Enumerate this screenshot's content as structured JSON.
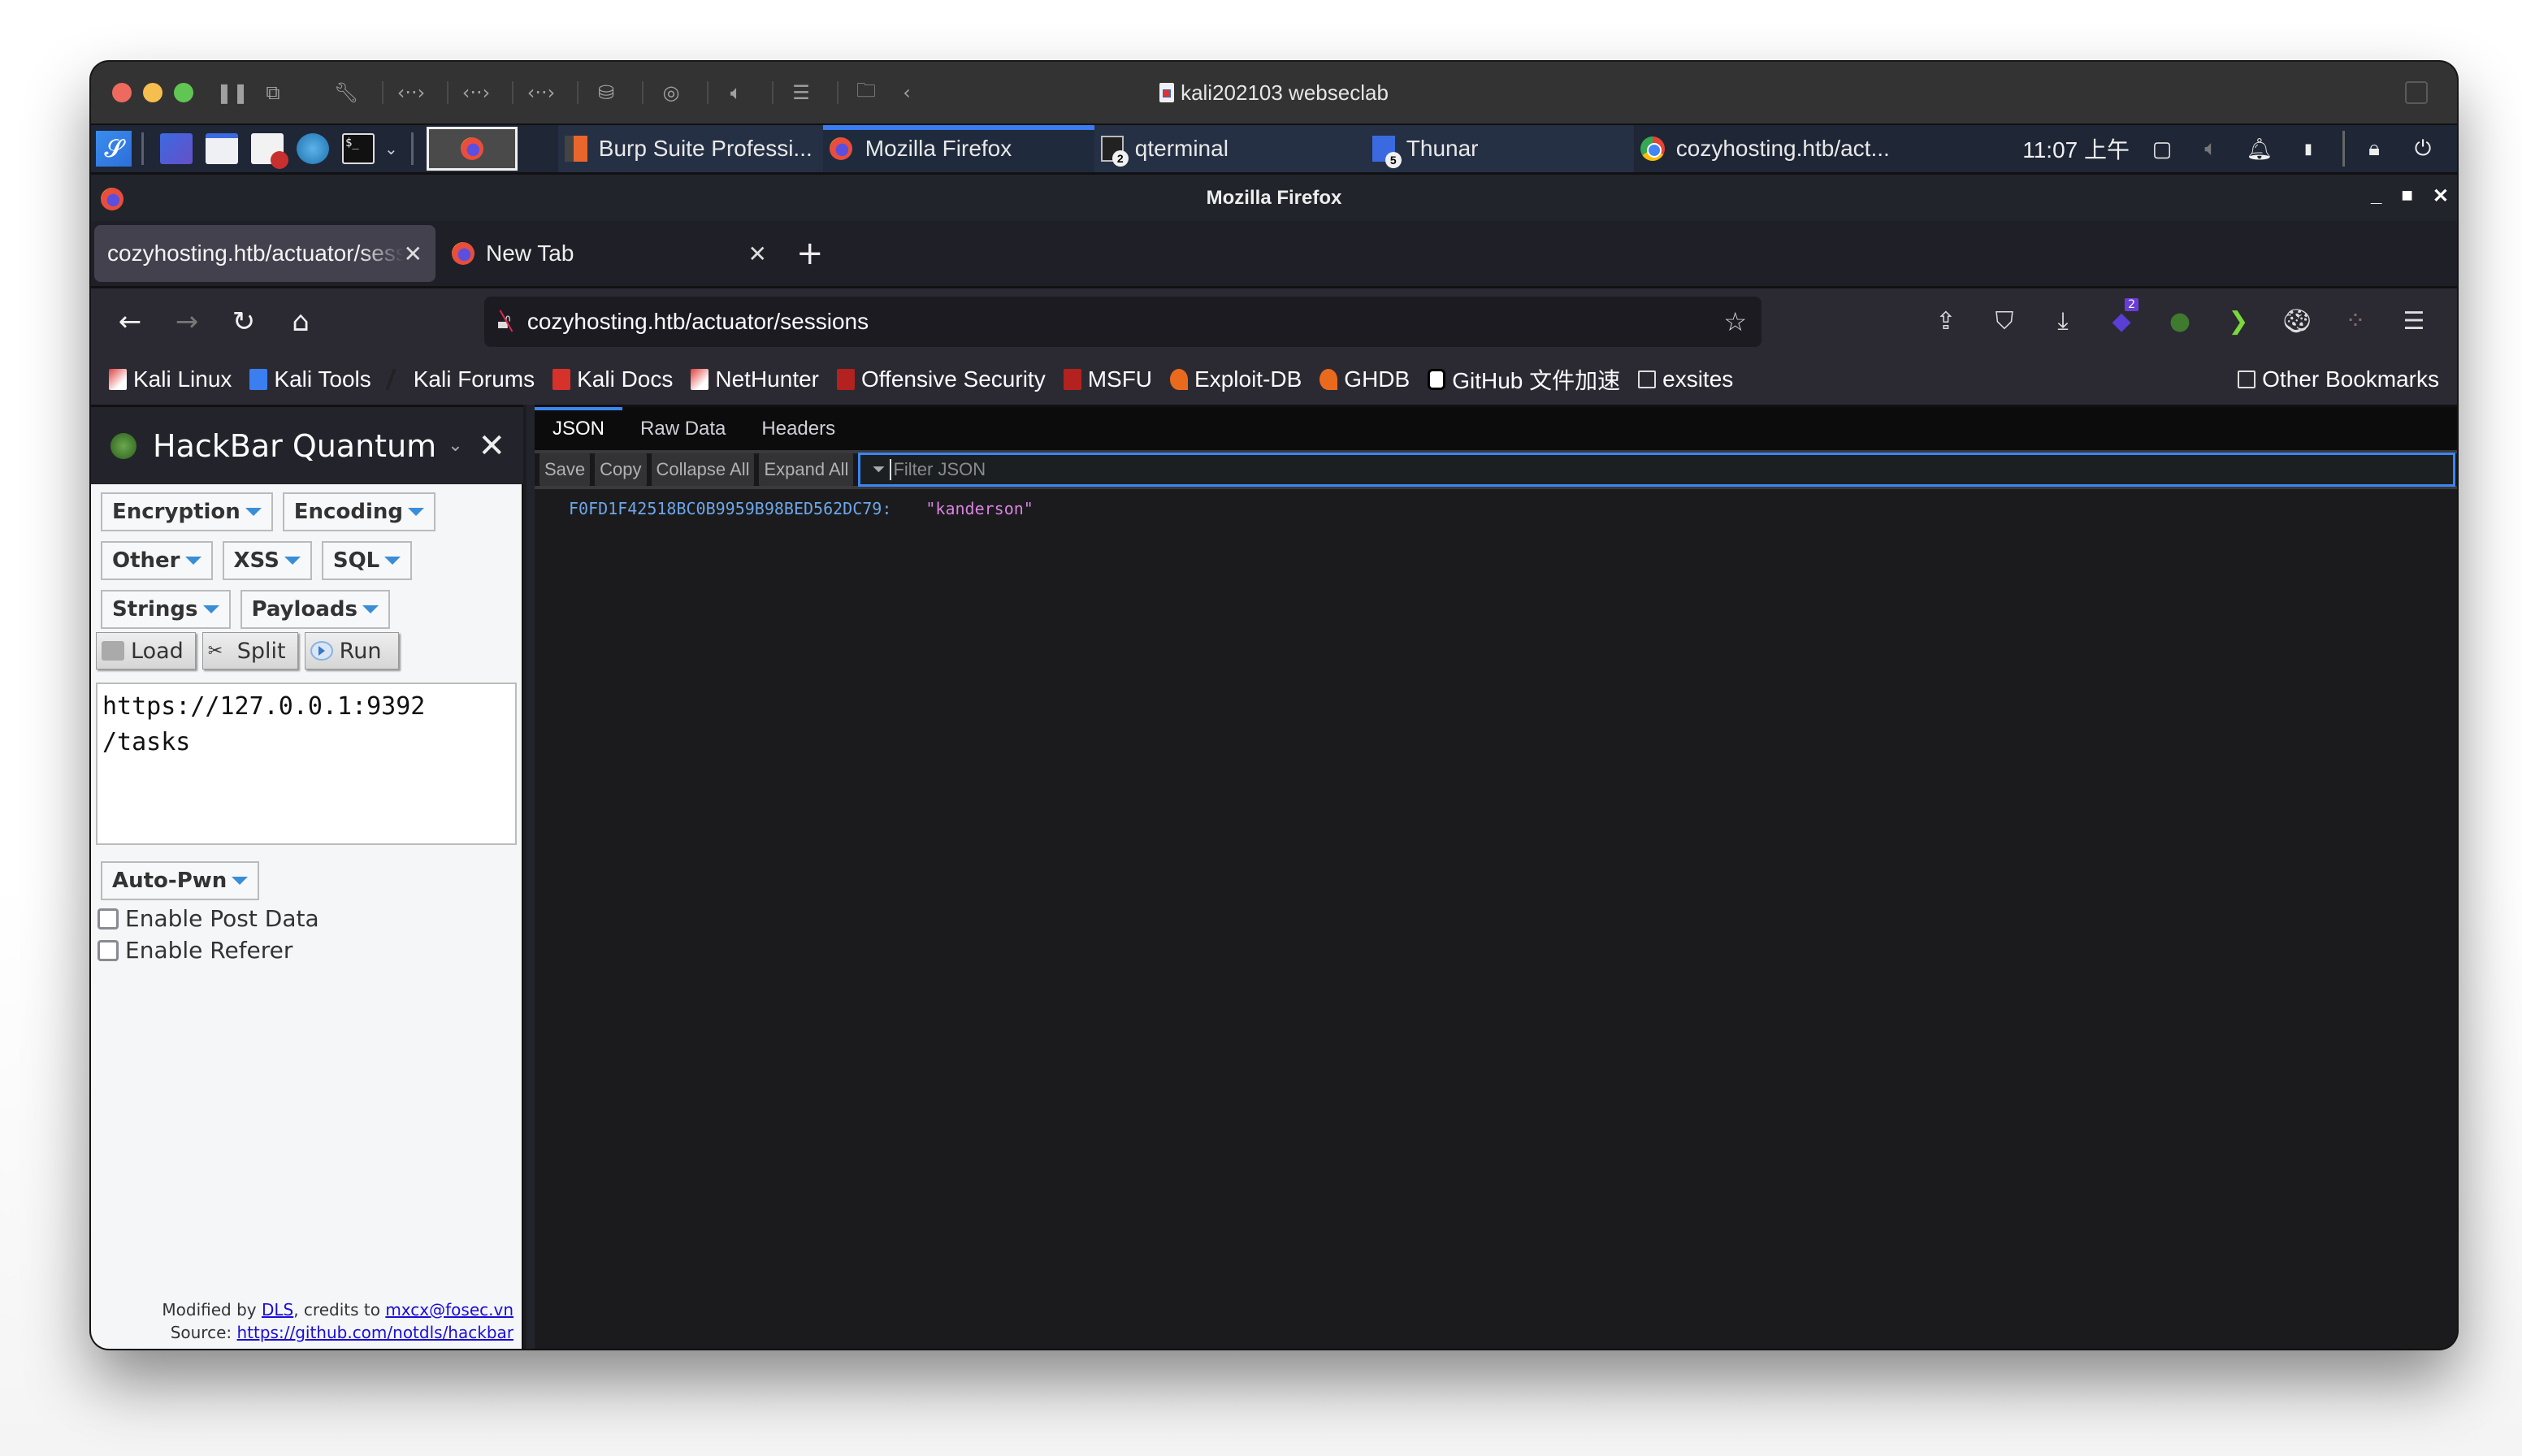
{
  "vm": {
    "title": "kali202103 webseclab",
    "toolbar_icons": [
      "pause-icon",
      "snapshot-icon",
      "settings-wrench-icon",
      "network-icon",
      "network-icon",
      "network-icon",
      "disk-icon",
      "cd-icon",
      "sound-icon",
      "storage-icon",
      "shared-folder-icon",
      "collapse-icon"
    ]
  },
  "kali_panel": {
    "launchers": [
      "kali-menu-icon",
      "desktop-icon",
      "file-manager-icon",
      "text-editor-icon",
      "browser-icon",
      "terminal-icon"
    ],
    "tasks": [
      {
        "label": "Burp Suite Professi...",
        "icon": "burp-icon",
        "active": false
      },
      {
        "label": "Mozilla Firefox",
        "icon": "firefox-icon",
        "active": true
      },
      {
        "label": "qterminal",
        "icon": "terminal-icon",
        "badge": "2",
        "active": false
      },
      {
        "label": "Thunar",
        "icon": "folder-icon",
        "badge": "5",
        "active": false
      },
      {
        "label": "cozyhosting.htb/act...",
        "icon": "chrome-icon",
        "active": false
      }
    ],
    "clock": "11:07 上午"
  },
  "firefox": {
    "window_title": "Mozilla Firefox",
    "tabs": [
      {
        "label": "cozyhosting.htb/actuator/sessions",
        "selected": true
      },
      {
        "label": "New Tab",
        "selected": false
      }
    ],
    "url": "cozyhosting.htb/actuator/sessions",
    "toolbar_badge": "2",
    "bookmarks": [
      {
        "label": "Kali Linux"
      },
      {
        "label": "Kali Tools"
      },
      {
        "label": "Kali Forums"
      },
      {
        "label": "Kali Docs"
      },
      {
        "label": "NetHunter"
      },
      {
        "label": "Offensive Security"
      },
      {
        "label": "MSFU"
      },
      {
        "label": "Exploit-DB"
      },
      {
        "label": "GHDB"
      },
      {
        "label": "GitHub 文件加速"
      },
      {
        "label": "exsites"
      }
    ],
    "other_bookmarks": "Other Bookmarks"
  },
  "hackbar": {
    "title": "HackBar Quantum",
    "menus_row1": [
      "Encryption",
      "Encoding"
    ],
    "menus_row2": [
      "Other",
      "XSS",
      "SQL"
    ],
    "menus_row3": [
      "Strings",
      "Payloads"
    ],
    "actions": {
      "load": "Load",
      "split": "Split",
      "run": "Run"
    },
    "url_value": "https://127.0.0.1:9392\n/tasks",
    "autopwn": "Auto-Pwn",
    "enable_post": {
      "label": "Enable Post Data",
      "checked": false
    },
    "enable_referer": {
      "label": "Enable Referer",
      "checked": false
    },
    "footer": {
      "modified_prefix": "Modified by ",
      "modified_link": "DLS",
      "credits_prefix": ", credits to ",
      "credits_link": "mxcx@fosec.vn",
      "source_prefix": "Source: ",
      "source_link": "https://github.com/notdls/hackbar"
    }
  },
  "json_viewer": {
    "tabs": [
      "JSON",
      "Raw Data",
      "Headers"
    ],
    "selected_tab": "JSON",
    "buttons": {
      "save": "Save",
      "copy": "Copy",
      "collapse": "Collapse All",
      "expand": "Expand All"
    },
    "filter_placeholder": "Filter JSON",
    "rows": [
      {
        "key": "F0FD1F42518BC0B9959B98BED562DC79:",
        "value": "\"kanderson\""
      }
    ]
  }
}
